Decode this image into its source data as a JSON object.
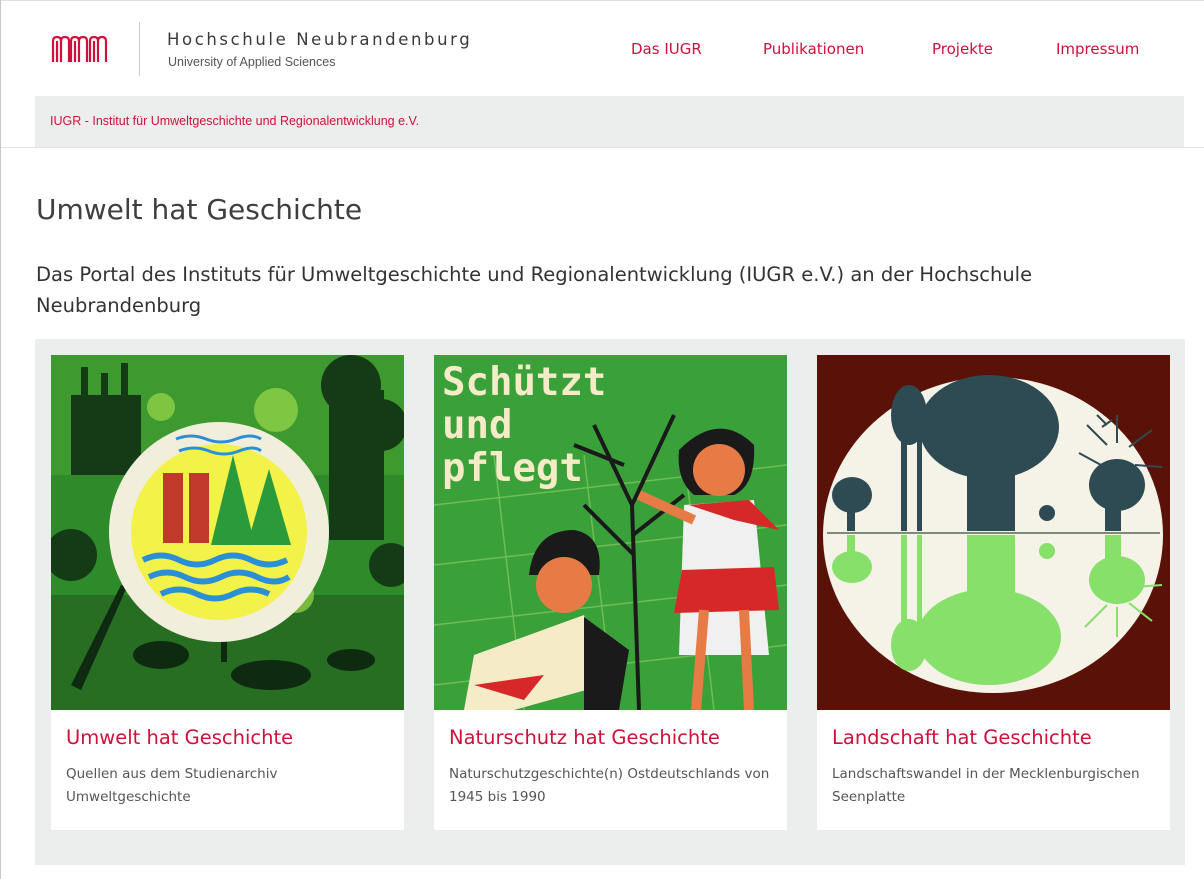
{
  "header": {
    "brand_name": "Hochschule Neubrandenburg",
    "brand_sub": "University of Applied Sciences",
    "logo_icon": "hs-neubrandenburg-logo-icon",
    "accent_color": "#d0103a",
    "nav": [
      {
        "label": "Das IUGR"
      },
      {
        "label": "Publikationen"
      },
      {
        "label": "Projekte"
      },
      {
        "label": "Impressum"
      }
    ]
  },
  "breadcrumb": {
    "label": "IUGR - Institut für Umweltgeschichte und Regionalentwicklung e.V."
  },
  "main": {
    "title": "Umwelt hat Geschichte",
    "intro": "Das Portal des Instituts für Umweltgeschichte und Regionalentwicklung (IUGR e.V.) an der Hochschule Neubrandenburg",
    "cards": [
      {
        "title": "Umwelt hat Geschichte",
        "text": "Quellen aus dem Studienarchiv Umweltgeschichte",
        "image": "environment-emblem-poster"
      },
      {
        "title": "Naturschutz hat Geschichte",
        "text": "Naturschutzgeschichte(n) Ostdeutschlands von 1945 bis 1990",
        "image": "children-planting-tree-poster",
        "image_text": [
          "Schützt",
          "und",
          "pflegt"
        ]
      },
      {
        "title": "Landschaft hat Geschichte",
        "text": "Landschaftswandel in der Mecklenburgischen Seenplatte",
        "image": "tree-reflection-lake-print"
      }
    ]
  }
}
